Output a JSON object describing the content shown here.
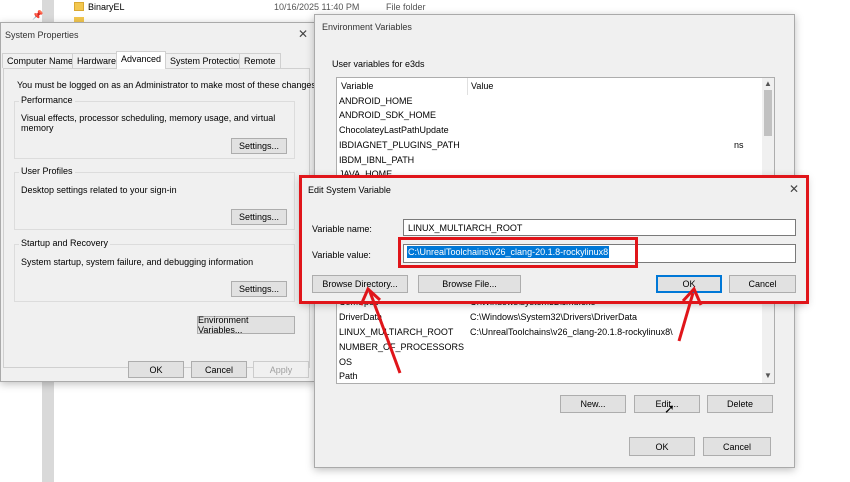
{
  "explorer": {
    "rows": [
      {
        "name": "BinaryEL",
        "date": "10/16/2025 11:40 PM",
        "type": "File folder"
      },
      {
        "name": "",
        "date": "",
        "type": ""
      }
    ]
  },
  "system_properties": {
    "title": "System Properties",
    "tabs": [
      "Computer Name",
      "Hardware",
      "Advanced",
      "System Protection",
      "Remote"
    ],
    "active_tab": "Advanced",
    "admin_note": "You must be logged on as an Administrator to make most of these changes.",
    "performance": {
      "title": "Performance",
      "desc": "Visual effects, processor scheduling, memory usage, and virtual memory",
      "button": "Settings..."
    },
    "user_profiles": {
      "title": "User Profiles",
      "desc": "Desktop settings related to your sign-in",
      "button": "Settings..."
    },
    "startup": {
      "title": "Startup and Recovery",
      "desc": "System startup, system failure, and debugging information",
      "button": "Settings..."
    },
    "env_button": "Environment Variables...",
    "ok": "OK",
    "cancel": "Cancel",
    "apply": "Apply"
  },
  "env_vars": {
    "title": "Environment Variables",
    "user_label": "User variables for e3ds",
    "col_variable": "Variable",
    "col_value": "Value",
    "user_rows": [
      {
        "name": "ANDROID_HOME",
        "value": ""
      },
      {
        "name": "ANDROID_SDK_HOME",
        "value": ""
      },
      {
        "name": "ChocolateyLastPathUpdate",
        "value": ""
      },
      {
        "name": "IBDIAGNET_PLUGINS_PATH",
        "value": "ns"
      },
      {
        "name": "IBDM_IBNL_PATH",
        "value": ""
      },
      {
        "name": "JAVA_HOME",
        "value": ""
      }
    ],
    "system_rows": [
      {
        "name": "ComSpec",
        "value": "C:\\Windows\\system32\\cmd.exe"
      },
      {
        "name": "DriverData",
        "value": "C:\\Windows\\System32\\Drivers\\DriverData"
      },
      {
        "name": "LINUX_MULTIARCH_ROOT",
        "value": "C:\\UnrealToolchains\\v26_clang-20.1.8-rockylinux8\\"
      },
      {
        "name": "NUMBER_OF_PROCESSORS",
        "value": ""
      },
      {
        "name": "OS",
        "value": ""
      },
      {
        "name": "Path",
        "value": ""
      }
    ],
    "new": "New...",
    "edit": "Edit...",
    "delete": "Delete",
    "ok": "OK",
    "cancel": "Cancel"
  },
  "edit_dialog": {
    "title": "Edit System Variable",
    "name_label": "Variable name:",
    "name_value": "LINUX_MULTIARCH_ROOT",
    "value_label": "Variable value:",
    "value_value": "C:\\UnrealToolchains\\v26_clang-20.1.8-rockylinux8",
    "browse_dir": "Browse Directory...",
    "browse_file": "Browse File...",
    "ok": "OK",
    "cancel": "Cancel"
  },
  "colors": {
    "highlight": "#e0151a",
    "selection": "#0078d7",
    "arrow": "#e0151a"
  }
}
